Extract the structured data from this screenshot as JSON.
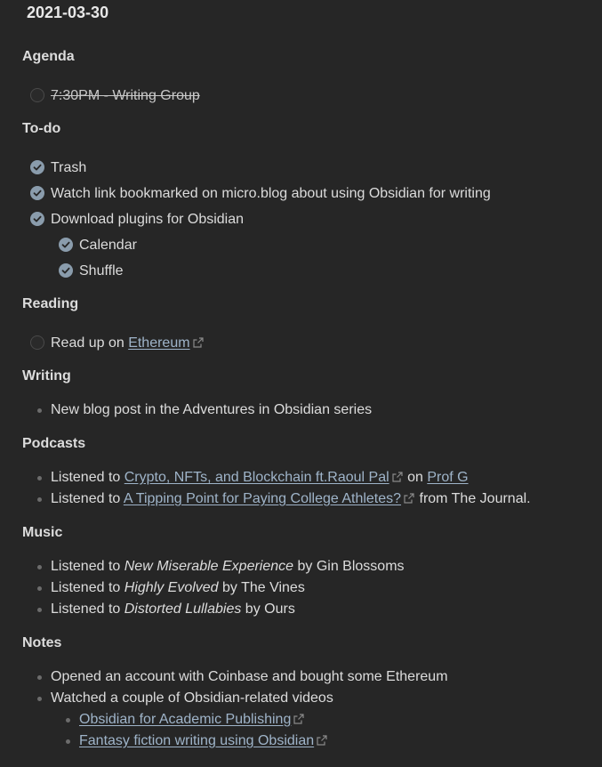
{
  "note": {
    "title": "2021-03-30"
  },
  "agenda": {
    "heading": "Agenda",
    "items": [
      {
        "label": "7:30PM - Writing Group"
      }
    ]
  },
  "todo": {
    "heading": "To-do",
    "items": [
      {
        "label": "Trash"
      },
      {
        "label": "Watch link bookmarked on micro.blog about using Obsidian for writing"
      },
      {
        "label": "Download plugins for Obsidian"
      },
      {
        "label": "Calendar"
      },
      {
        "label": "Shuffle"
      }
    ]
  },
  "reading": {
    "heading": "Reading",
    "item": {
      "prefix": "Read up on ",
      "link": "Ethereum"
    }
  },
  "writing": {
    "heading": "Writing",
    "items": [
      {
        "label": "New blog post in the Adventures in Obsidian series"
      }
    ]
  },
  "podcasts": {
    "heading": "Podcasts",
    "items": [
      {
        "prefix": "Listened to ",
        "link": "Crypto, NFTs, and Blockchain ft.Raoul Pal",
        "middle": " on ",
        "link2": "Prof G",
        "suffix": ""
      },
      {
        "prefix": "Listened to ",
        "link": "A Tipping Point for Paying College Athletes?",
        "suffix": " from The Journal."
      }
    ]
  },
  "music": {
    "heading": "Music",
    "items": [
      {
        "prefix": "Listened to ",
        "album": "New Miserable Experience",
        "suffix": " by Gin Blossoms"
      },
      {
        "prefix": "Listened to ",
        "album": "Highly Evolved",
        "suffix": " by The Vines"
      },
      {
        "prefix": "Listened to ",
        "album": "Distorted Lullabies",
        "suffix": " by Ours"
      }
    ]
  },
  "notes": {
    "heading": "Notes",
    "items": [
      {
        "label": "Opened an account with Coinbase and bought some Ethereum"
      },
      {
        "label": "Watched a couple of Obsidian-related videos"
      }
    ],
    "links": [
      {
        "link": "Obsidian for Academic Publishing"
      },
      {
        "link": "Fantasy fiction writing using Obsidian"
      }
    ]
  },
  "icons": {
    "checkbox_checked": "check-circle-icon",
    "checkbox_empty": "empty-circle-icon",
    "external_link": "external-link-icon",
    "bullet": "bullet-dot-icon"
  },
  "colors": {
    "background": "#262626",
    "text": "#dcdcdc",
    "link": "#9fb4c9",
    "checkbox_checked": "#8a9cac"
  }
}
